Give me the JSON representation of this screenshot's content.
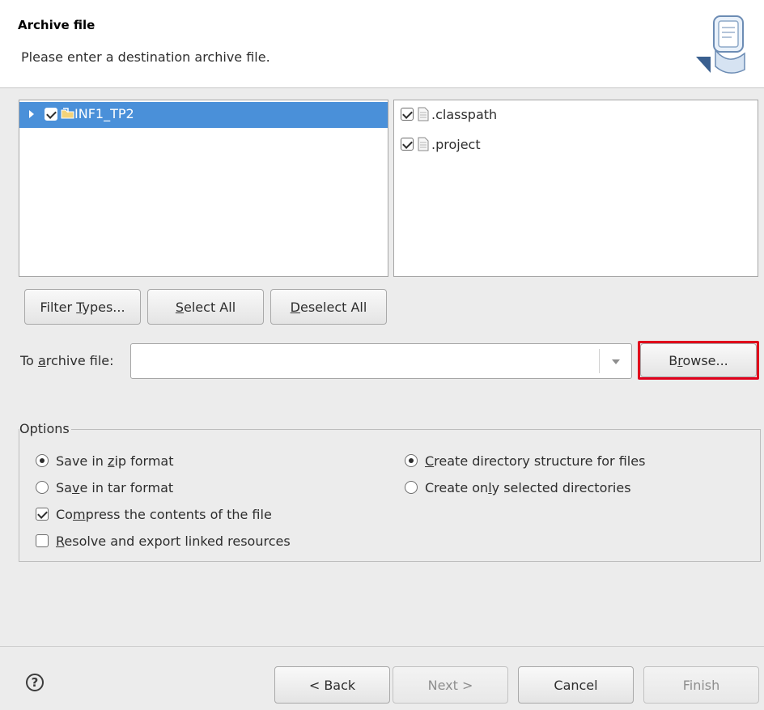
{
  "header": {
    "title": "Archive file",
    "message": "Please enter a destination archive file.",
    "icon": "export-archive-icon"
  },
  "resources": {
    "tree": [
      {
        "label": "INF1_TP2",
        "checked": true,
        "expanded": false,
        "selected": true,
        "icon": "project-folder-icon"
      }
    ],
    "files": [
      {
        "label": ".classpath",
        "checked": true,
        "icon": "file-icon"
      },
      {
        "label": ".project",
        "checked": true,
        "icon": "file-icon"
      }
    ]
  },
  "buttons": {
    "filter_types": {
      "pre": "Filter ",
      "u": "T",
      "post": "ypes..."
    },
    "select_all": {
      "pre": "",
      "u": "S",
      "post": "elect All"
    },
    "deselect_all": {
      "pre": "",
      "u": "D",
      "post": "eselect All"
    }
  },
  "archive": {
    "label_pre": "To ",
    "label_u": "a",
    "label_post": "rchive file:",
    "value": "",
    "browse": {
      "pre": "B",
      "u": "r",
      "post": "owse..."
    },
    "highlight_color": "#e0001b"
  },
  "options": {
    "legend": "Options",
    "save_zip": {
      "pre": "Save in ",
      "u": "z",
      "post": "ip format",
      "selected": true
    },
    "save_tar": {
      "pre": "Sa",
      "u": "v",
      "post": "e in tar format",
      "selected": false
    },
    "compress": {
      "pre": "Co",
      "u": "m",
      "post": "press the contents of the file",
      "checked": true
    },
    "resolve_linked": {
      "pre": "",
      "u": "R",
      "post": "esolve and export linked resources",
      "checked": false
    },
    "create_structure": {
      "pre": "",
      "u": "C",
      "post": "reate directory structure for files",
      "selected": true
    },
    "only_selected": {
      "pre": "Create on",
      "u": "l",
      "post": "y selected directories",
      "selected": false
    }
  },
  "footer": {
    "help": "?",
    "back": "< Back",
    "next": "Next >",
    "cancel": "Cancel",
    "finish": "Finish",
    "next_enabled": false,
    "finish_enabled": false
  },
  "colors": {
    "selection": "#4a90d9",
    "background": "#ececec"
  }
}
